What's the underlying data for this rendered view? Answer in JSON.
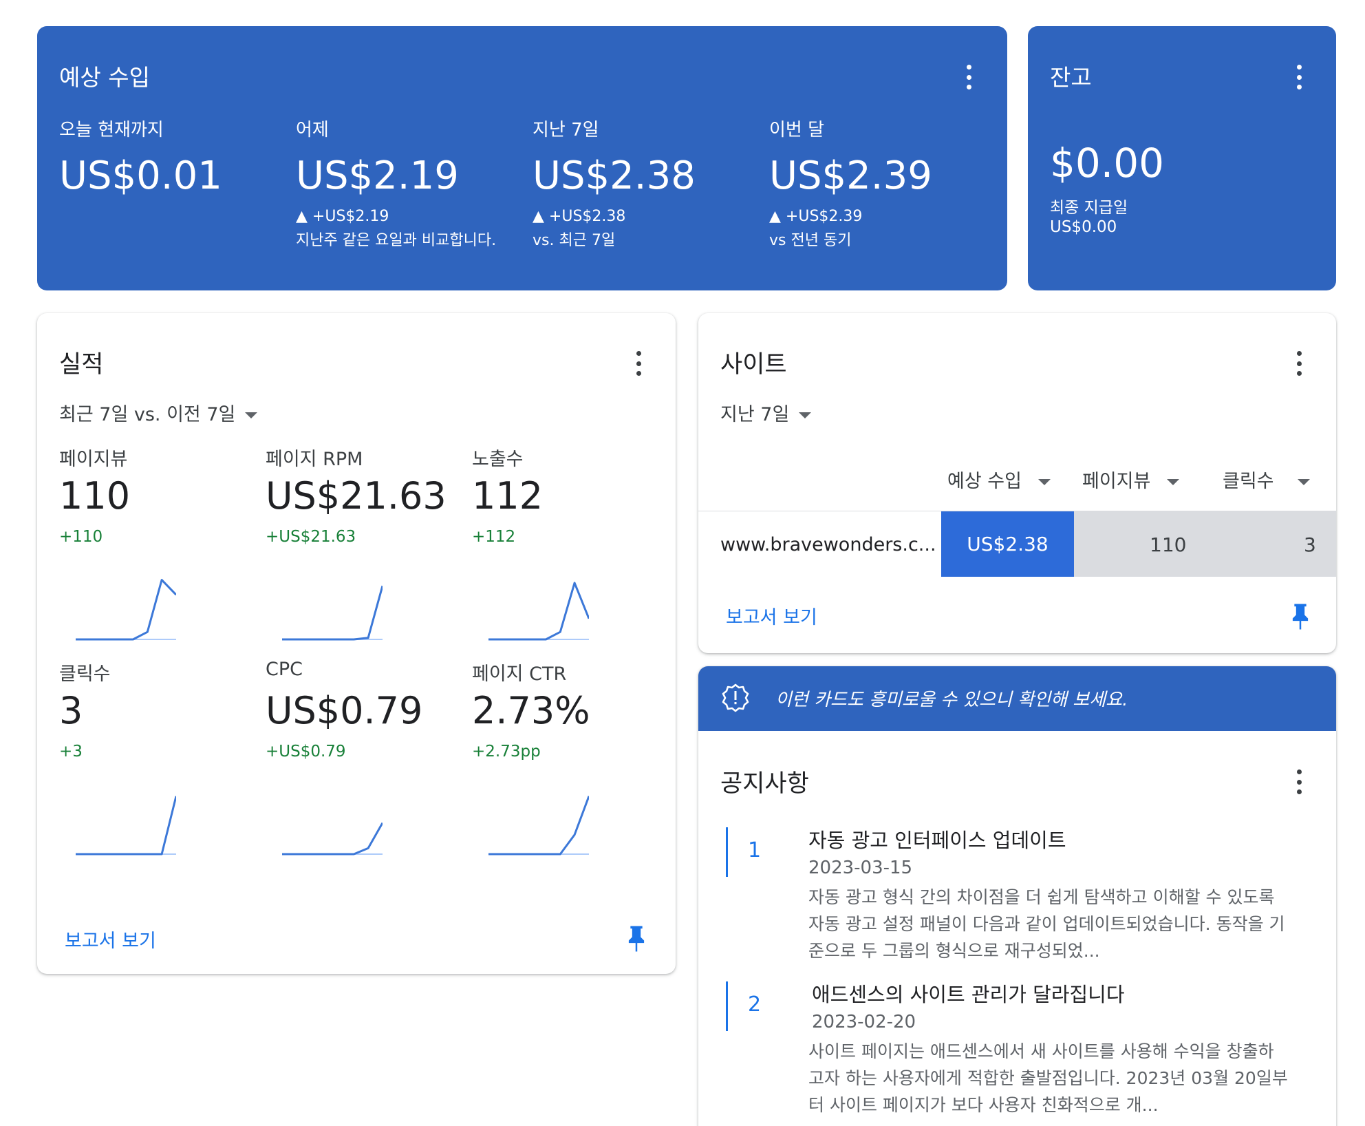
{
  "earnings": {
    "title": "예상 수입",
    "items": [
      {
        "label": "오늘 현재까지",
        "value": "US$0.01",
        "delta": "",
        "note": ""
      },
      {
        "label": "어제",
        "value": "US$2.19",
        "delta": "▲ +US$2.19",
        "note": "지난주 같은 요일과 비교합니다."
      },
      {
        "label": "지난 7일",
        "value": "US$2.38",
        "delta": "▲ +US$2.38",
        "note": "vs. 최근 7일"
      },
      {
        "label": "이번 달",
        "value": "US$2.39",
        "delta": "▲ +US$2.39",
        "note": "vs 전년 동기"
      }
    ]
  },
  "balance": {
    "title": "잔고",
    "value": "$0.00",
    "last_payment_label": "최종 지급일",
    "last_payment_value": "US$0.00"
  },
  "performance": {
    "title": "실적",
    "period": "최근 7일 vs. 이전 7일",
    "metrics": [
      {
        "label": "페이지뷰",
        "value": "110",
        "delta": "+110",
        "spark": [
          0,
          0,
          0,
          0,
          0,
          0.1,
          0.8,
          0.6
        ]
      },
      {
        "label": "페이지 RPM",
        "value": "US$21.63",
        "delta": "+US$21.63",
        "spark": [
          0,
          0,
          0,
          0,
          0,
          0,
          0.02,
          0.72
        ]
      },
      {
        "label": "노출수",
        "value": "112",
        "delta": "+112",
        "spark": [
          0,
          0,
          0,
          0,
          0,
          0.1,
          0.76,
          0.28
        ]
      },
      {
        "label": "클릭수",
        "value": "3",
        "delta": "+3",
        "spark": [
          0,
          0,
          0,
          0,
          0,
          0,
          0,
          0.78
        ]
      },
      {
        "label": "CPC",
        "value": "US$0.79",
        "delta": "+US$0.79",
        "spark": [
          0,
          0,
          0,
          0,
          0,
          0,
          0.08,
          0.42
        ]
      },
      {
        "label": "페이지 CTR",
        "value": "2.73%",
        "delta": "+2.73pp",
        "spark": [
          0,
          0,
          0,
          0,
          0,
          0,
          0.26,
          0.78
        ]
      }
    ],
    "report_link": "보고서 보기"
  },
  "sites": {
    "title": "사이트",
    "period": "지난 7일",
    "columns": [
      "예상 수입",
      "페이지뷰",
      "클릭수"
    ],
    "rows": [
      {
        "site": "www.bravewonders.c...",
        "earnings": "US$2.38",
        "pageviews": "110",
        "clicks": "3"
      }
    ],
    "report_link": "보고서 보기"
  },
  "banner": {
    "text": "이런 카드도 흥미로울 수 있으니 확인해 보세요."
  },
  "notices": {
    "title": "공지사항",
    "items": [
      {
        "num": "1",
        "title": "자동 광고 인터페이스 업데이트",
        "date": "2023-03-15",
        "lines": [
          "자동 광고 형식 간의 차이점을 더 쉽게 탐색하고 이해할 수 있도록",
          "자동 광고 설정 패널이 다음과 같이 업데이트되었습니다. 동작을 기",
          "준으로 두 그룹의 형식으로 재구성되었..."
        ]
      },
      {
        "num": "2",
        "title": "애드센스의 사이트 관리가 달라집니다",
        "date": "2023-02-20",
        "lines": [
          "사이트 페이지는 애드센스에서 새 사이트를 사용해 수익을 창출하",
          "고자 하는 사용자에게 적합한 출발점입니다. 2023년 03월 20일부",
          "터 사이트 페이지가 보다 사용자 친화적으로 개..."
        ]
      }
    ]
  },
  "colors": {
    "brand_blue": "#2f64be",
    "accent_blue": "#1a73e8",
    "positive_green": "#188038",
    "bar_blue": "#2d6bd9",
    "bar_grey": "#dadce0"
  },
  "icons": [
    "more-vert-icon",
    "dropdown-arrow-icon",
    "pin-icon",
    "alert-badge-icon",
    "sparkline-icon"
  ]
}
